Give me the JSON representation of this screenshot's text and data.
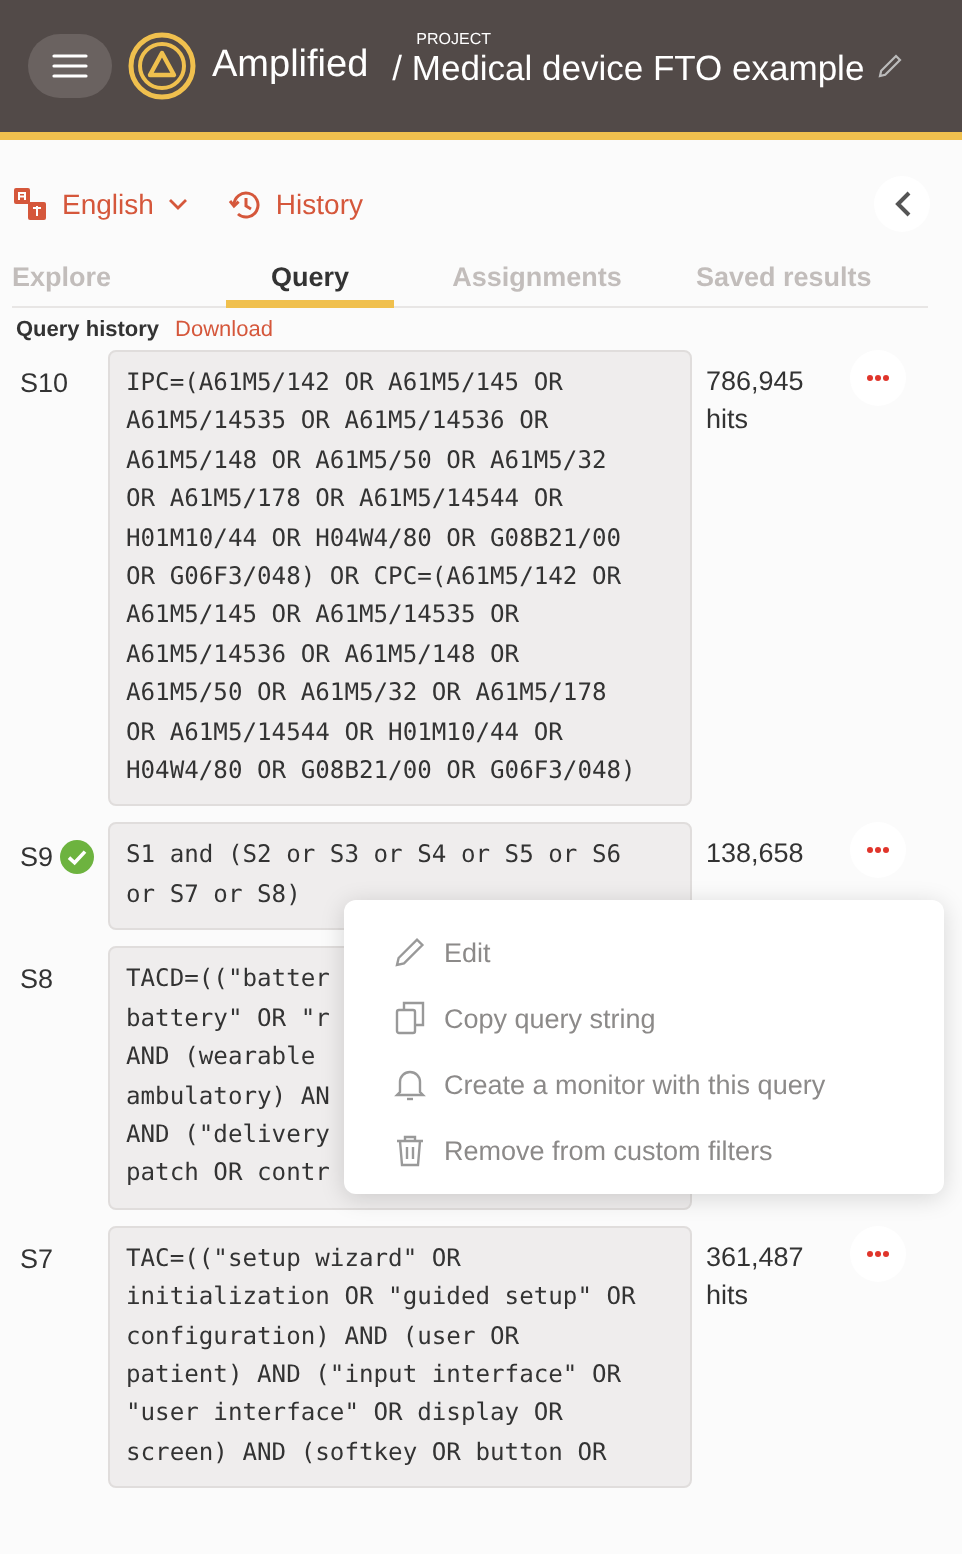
{
  "header": {
    "app_name": "Amplified",
    "project_label": "PROJECT",
    "project_title": "/ Medical device FTO example"
  },
  "toolbar": {
    "language": "English",
    "history": "History"
  },
  "tabs": [
    {
      "label": "Explore",
      "selected": false
    },
    {
      "label": "Query",
      "selected": true
    },
    {
      "label": "Assignments",
      "selected": false
    },
    {
      "label": "Saved results",
      "selected": false
    }
  ],
  "section": {
    "title": "Query history",
    "link": "Download"
  },
  "queries": [
    {
      "id": "S10",
      "checked": false,
      "query": "IPC=(A61M5/142 OR A61M5/145 OR A61M5/14535 OR A61M5/14536 OR A61M5/148 OR A61M5/50 OR A61M5/32 OR A61M5/178 OR A61M5/14544 OR H01M10/44 OR H04W4/80 OR G08B21/00 OR G06F3/048) OR CPC=(A61M5/142 OR A61M5/145 OR A61M5/14535 OR A61M5/14536 OR A61M5/148 OR A61M5/50 OR A61M5/32 OR A61M5/178 OR A61M5/14544 OR H01M10/44 OR H04W4/80 OR G08B21/00 OR G06F3/048)",
      "count": "786,945",
      "unit": "hits",
      "more": true
    },
    {
      "id": "S9",
      "checked": true,
      "query": "S1 and (S2 or S3 or S4 or S5 or S6 or S7 or S8)",
      "count": "138,658",
      "more": true
    },
    {
      "id": "S8",
      "checked": false,
      "query": "TACD=((\"batter\nbattery\" OR \"r\nAND (wearable\nambulatory) AN\nAND (\"delivery\npatch OR contr"
    },
    {
      "id": "S7",
      "checked": false,
      "query": "TAC=((\"setup wizard\" OR initialization OR \"guided setup\" OR configuration) AND (user OR patient) AND (\"input interface\" OR \"user interface\" OR display OR screen) AND (softkey OR button OR",
      "count": "361,487",
      "unit": "hits",
      "more": true
    }
  ],
  "context_menu": [
    {
      "kind": "edit",
      "label": "Edit"
    },
    {
      "kind": "copy",
      "label": "Copy query string"
    },
    {
      "kind": "bell",
      "label": "Create a monitor with this query"
    },
    {
      "kind": "trash",
      "label": "Remove from custom filters"
    }
  ]
}
